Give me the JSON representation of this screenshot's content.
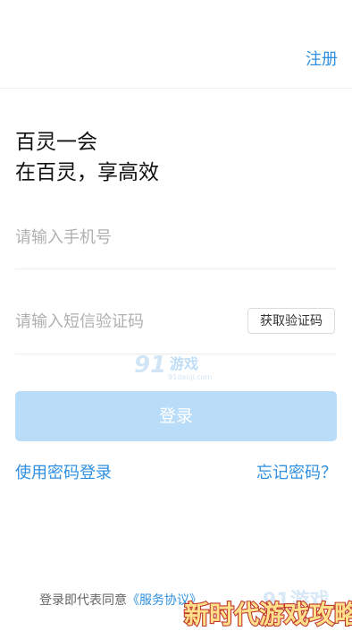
{
  "header": {
    "register_label": "注册"
  },
  "slogan": {
    "line1": "百灵一会",
    "line2": "在百灵，享高效"
  },
  "phone": {
    "placeholder": "请输入手机号"
  },
  "code": {
    "placeholder": "请输入短信验证码",
    "get_code_label": "获取验证码"
  },
  "login": {
    "button_label": "登录"
  },
  "links": {
    "password_login": "使用密码登录",
    "forgot_password": "忘记密码？"
  },
  "agreement": {
    "prefix": "登录即代表同意",
    "service_link": "《服务协议》"
  },
  "watermarks": {
    "top_brand": "游戏",
    "top_url": "91danji.com",
    "bottom_text": "新时代游戏攻略"
  },
  "colors": {
    "accent": "#2f8fe0",
    "login_disabled": "#b9dcf8",
    "divider": "#ececec"
  }
}
